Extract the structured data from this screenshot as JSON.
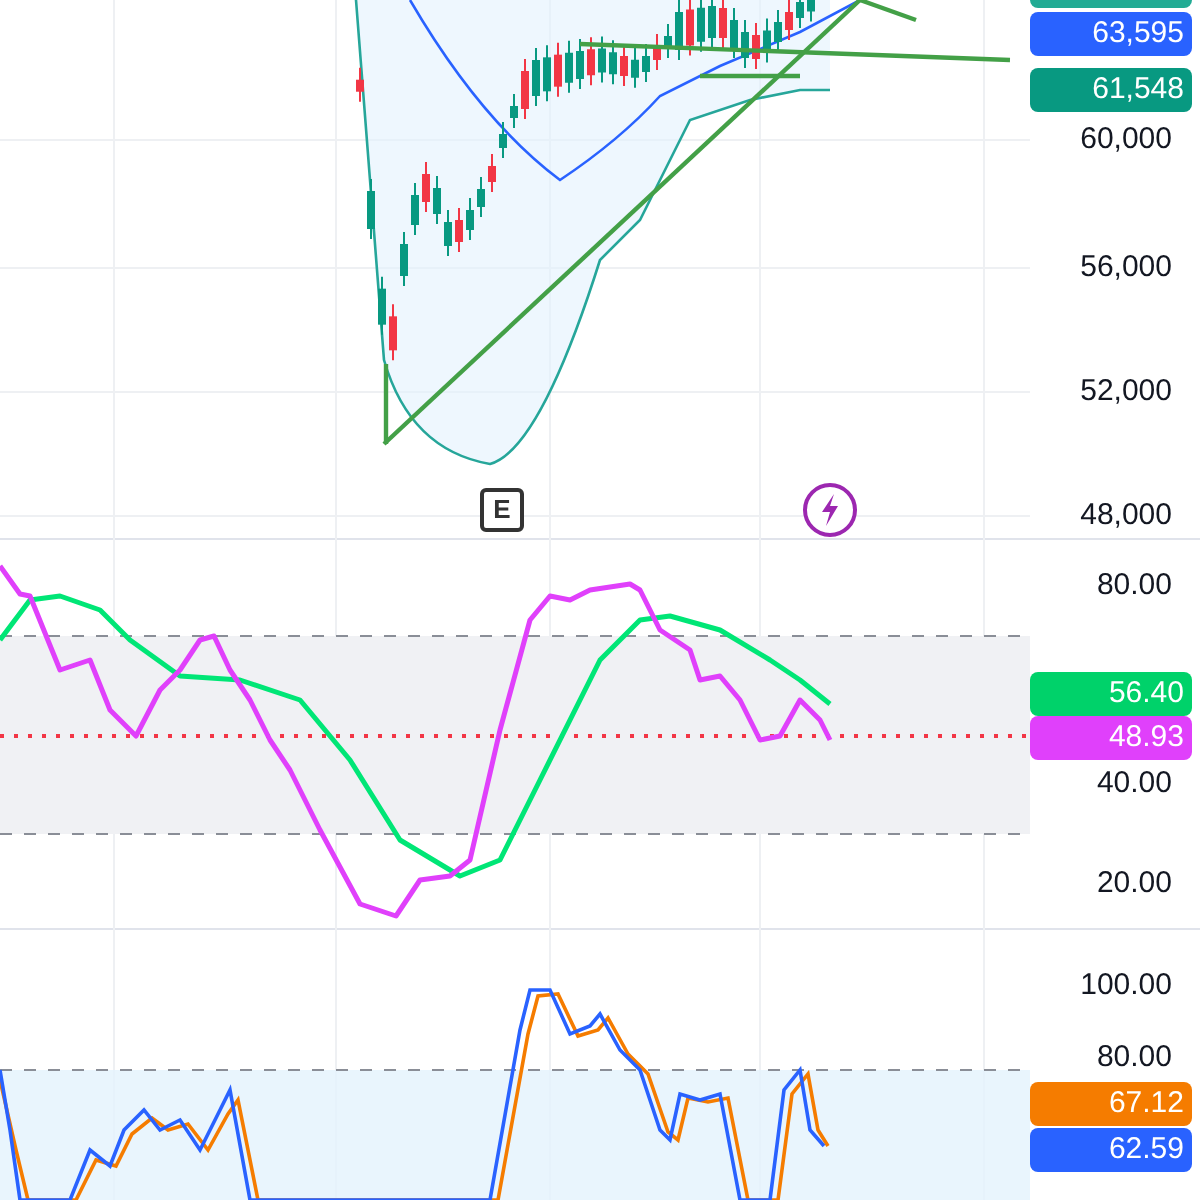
{
  "price_pane": {
    "event_marker": "E",
    "axis_labels": [
      "60,000",
      "56,000",
      "52,000",
      "48,000"
    ],
    "badges": [
      {
        "text": "63,595",
        "color": "#2962ff"
      },
      {
        "text": "61,548",
        "color": "#089981"
      }
    ]
  },
  "rsi_pane": {
    "axis_labels": [
      "80.00",
      "40.00",
      "20.00"
    ],
    "badges": [
      {
        "text": "56.40",
        "color": "#00d26a"
      },
      {
        "text": "48.93",
        "color": "#e040fb"
      }
    ]
  },
  "stoch_pane": {
    "axis_labels": [
      "100.00",
      "80.00"
    ],
    "badges": [
      {
        "text": "67.12",
        "color": "#f57c00"
      },
      {
        "text": "62.59",
        "color": "#2962ff"
      }
    ]
  }
}
